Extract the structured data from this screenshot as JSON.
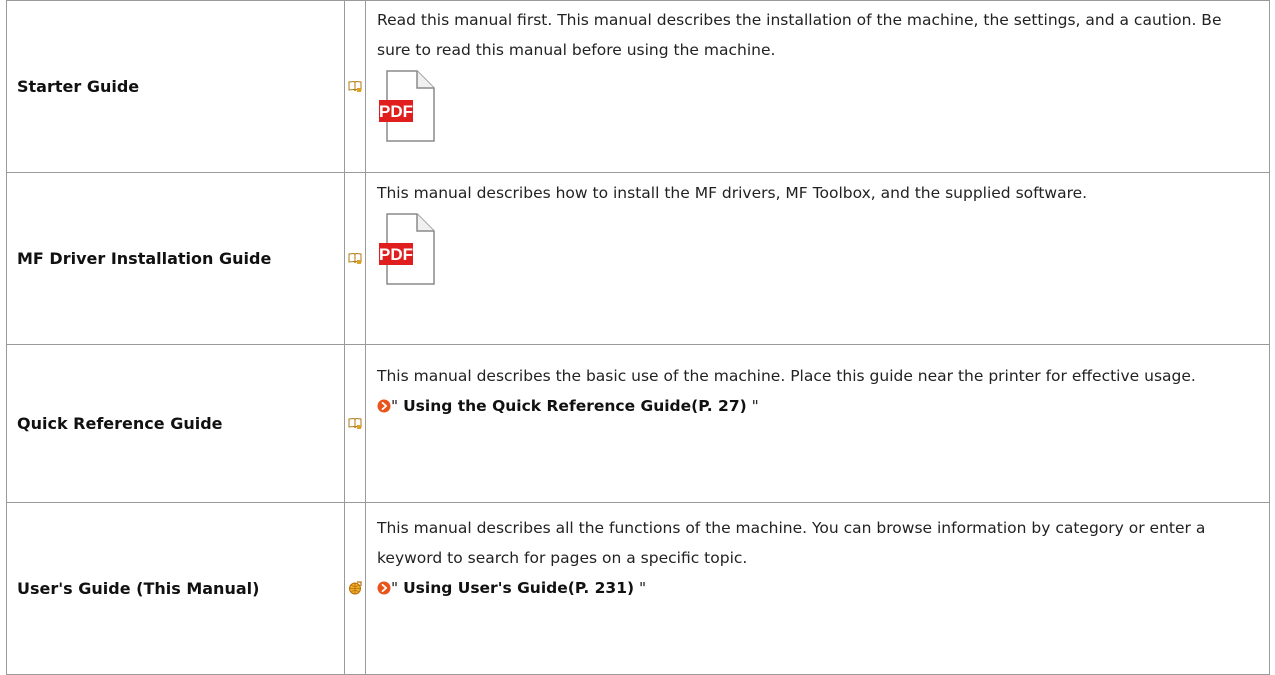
{
  "colors": {
    "border": "#9a9a9a",
    "pdf_red": "#e01e1e",
    "link_arrow": "#e8541a",
    "book_icon": "#d9941a",
    "web_icon": "#e89a18"
  },
  "rows": [
    {
      "name": "Starter Guide",
      "icon": "book-icon",
      "description": "Read this manual first. This manual describes the installation of the machine, the settings, and a caution. Be sure to read this manual before using the machine.",
      "pdf_label": "PDF"
    },
    {
      "name": "MF Driver Installation Guide",
      "icon": "book-icon",
      "description": "This manual describes how to install the MF drivers, MF Toolbox, and the supplied software.",
      "pdf_label": "PDF"
    },
    {
      "name": "Quick Reference Guide",
      "icon": "book-icon",
      "description": "This manual describes the basic use of the machine. Place this guide near the printer for effective usage.",
      "link": {
        "open_quote": "\"",
        "text": "Using the Quick Reference Guide(P. 27)",
        "close_quote": "\""
      }
    },
    {
      "name": "User's Guide (This Manual)",
      "icon": "web-icon",
      "description": "This manual describes all the functions of the machine. You can browse information by category or enter a keyword to search for pages on a specific topic.",
      "link": {
        "open_quote": "\"",
        "text": "Using User's Guide(P. 231)",
        "close_quote": "\""
      }
    }
  ]
}
